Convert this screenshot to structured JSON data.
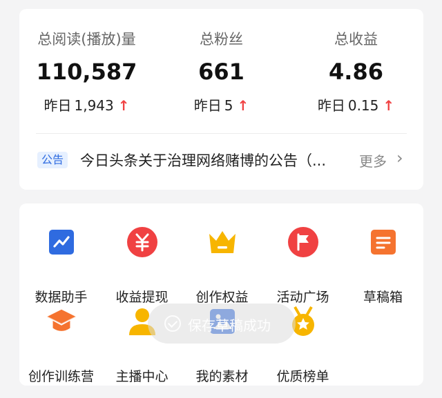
{
  "stats": [
    {
      "label": "总阅读(播放)量",
      "value": "110,587",
      "yesterday_label": "昨日",
      "yesterday_value": "1,943",
      "trend": "up"
    },
    {
      "label": "总粉丝",
      "value": "661",
      "yesterday_label": "昨日",
      "yesterday_value": "5",
      "trend": "up"
    },
    {
      "label": "总收益",
      "value": "4.86",
      "yesterday_label": "昨日",
      "yesterday_value": "0.15",
      "trend": "up"
    }
  ],
  "notice": {
    "badge": "公告",
    "text": "今日头条关于治理网络赌博的公告（...",
    "more": "更多"
  },
  "tools": [
    {
      "label": "数据助手",
      "icon": "chart-icon"
    },
    {
      "label": "收益提现",
      "icon": "yuan-icon"
    },
    {
      "label": "创作权益",
      "icon": "crown-icon"
    },
    {
      "label": "活动广场",
      "icon": "flag-icon"
    },
    {
      "label": "草稿箱",
      "icon": "draft-icon"
    },
    {
      "label": "创作训练营",
      "icon": "graduation-cap-icon"
    },
    {
      "label": "主播中心",
      "icon": "user-icon"
    },
    {
      "label": "我的素材",
      "icon": "image-icon"
    },
    {
      "label": "优质榜单",
      "icon": "medal-icon"
    }
  ],
  "toast": {
    "text": "保存草稿成功"
  },
  "colors": {
    "up_arrow": "#f04142",
    "blue": "#2f6be0",
    "red": "#f04142",
    "yellow": "#f7b500",
    "orange": "#f5732f"
  }
}
